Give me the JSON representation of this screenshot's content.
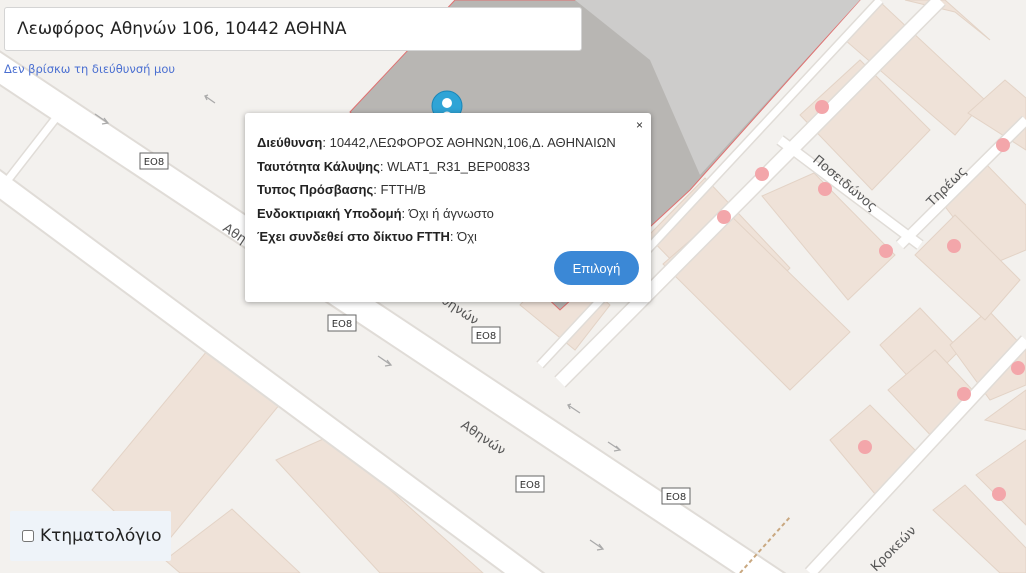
{
  "search": {
    "value": "Λεωφόρος Αθηνών 106, 10442 ΑΘΗΝΑ",
    "help_link": "Δεν βρίσκω τη διεύθυνσή μου"
  },
  "popup": {
    "close_label": "×",
    "rows": [
      {
        "label": "Διεύθυνση",
        "value": "10442,ΛΕΩΦΟΡΟΣ ΑΘΗΝΩΝ,106,Δ. ΑΘΗΝΑΙΩΝ"
      },
      {
        "label": "Ταυτότητα Κάλυψης",
        "value": "WLAT1_R31_BEP00833"
      },
      {
        "label": "Τυπος Πρόσβασης",
        "value": "FTTH/B"
      },
      {
        "label": "Ενδοκτιριακή Υποδομή",
        "value": "Όχι ή άγνωστο"
      },
      {
        "label": "Έχει συνδεθεί στο δίκτυο FTTH",
        "value": "Όχι"
      }
    ],
    "select_label": "Επιλογή"
  },
  "layers": {
    "cadastre_label": "Κτηματολόγιο",
    "cadastre_checked": false
  },
  "map": {
    "road_shields": [
      "ΕΟ8",
      "ΕΟ8",
      "ΕΟ8",
      "ΕΟ8",
      "ΕΟ8"
    ],
    "street_labels": [
      "Αθηνών",
      "Αθηνών",
      "Αθηνών",
      "Ποσειδώνος",
      "Τηρέως",
      "Κροκεών"
    ],
    "marker_icon": "map-pin-icon",
    "colors": {
      "background": "#f3f1ee",
      "building": "#efe2d8",
      "road": "#ffffff",
      "poi_dot": "#f3a6aa",
      "selected_area": "#b8b6b3",
      "accent": "#3b88d6"
    }
  }
}
